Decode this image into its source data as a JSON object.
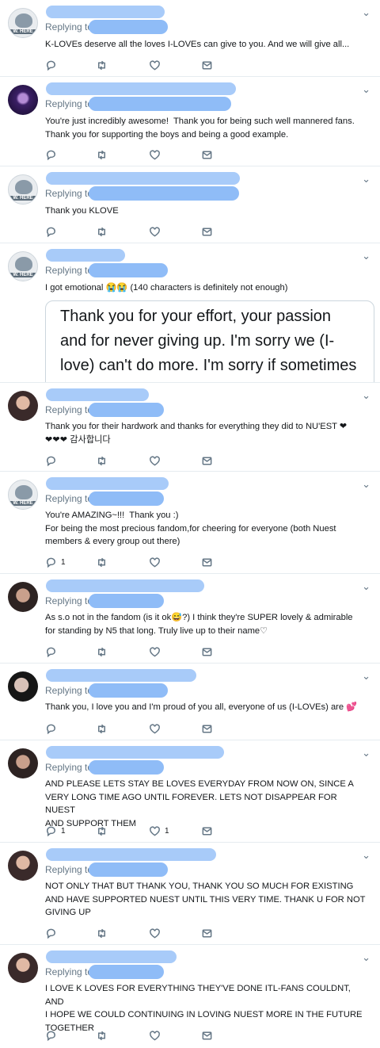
{
  "common": {
    "replying_to": "Replying to",
    "chevron": "⌄",
    "icons": [
      "reply-icon",
      "retweet-icon",
      "like-icon",
      "message-icon"
    ]
  },
  "tweets": [
    {
      "text": "K-LOVEs deserve all the loves I-LOVEs can give to you. And we will give all...",
      "reply_count": "",
      "like_count": ""
    },
    {
      "text": "You're just incredibly awesome!  Thank you for being such well mannered fans.\nThank you for supporting the boys and being a good example.",
      "reply_count": "",
      "like_count": ""
    },
    {
      "text": "Thank you KLOVE",
      "reply_count": "",
      "like_count": ""
    },
    {
      "text": "I got emotional 😭😭 (140 characters is definitely not enough)",
      "quote": "Thank you for your effort, your passion and for never giving up. I'm sorry we (I-love) can't do more. I'm sorry if sometimes it might seem like you're",
      "reply_count": "",
      "like_count": ""
    },
    {
      "text": "Thank you for their hardwork and thanks for everything they did to NU'EST ❤\n❤❤❤ 감사합니다",
      "reply_count": "",
      "like_count": ""
    },
    {
      "text": "You're AMAZING~!!!  Thank you :)\nFor being the most precious fandom,for cheering for everyone (both Nuest\nmembers & every group out there)",
      "reply_count": "1",
      "like_count": ""
    },
    {
      "text": "As s.o not in the fandom (is it ok😅?) I think they're SUPER lovely & admirable\nfor standing by N5 that long. Truly live up to their name♡",
      "reply_count": "",
      "like_count": ""
    },
    {
      "text": "Thank you, I love you and I'm proud of you all, everyone of us (I-LOVEs) are 💕",
      "reply_count": "",
      "like_count": ""
    },
    {
      "text": "AND PLEASE LETS STAY BE LOVES EVERYDAY FROM NOW ON, SINCE A\nVERY LONG TIME AGO UNTIL FOREVER. LETS NOT DISAPPEAR FOR NUEST\nAND SUPPORT THEM",
      "reply_count": "1",
      "like_count": "1"
    },
    {
      "text": "NOT ONLY THAT BUT THANK YOU, THANK YOU SO MUCH FOR EXISTING\nAND HAVE SUPPORTED NUEST UNTIL THIS VERY TIME. THANK U FOR NOT\nGIVING UP",
      "reply_count": "",
      "like_count": ""
    },
    {
      "text": "I LOVE K LOVES FOR EVERYTHING THEY'VE DONE ITL-FANS COULDNT, AND\nI HOPE WE COULD CONTINUING IN LOVING NUEST MORE IN THE FUTURE\nTOGETHER",
      "reply_count": "",
      "like_count": ""
    }
  ]
}
